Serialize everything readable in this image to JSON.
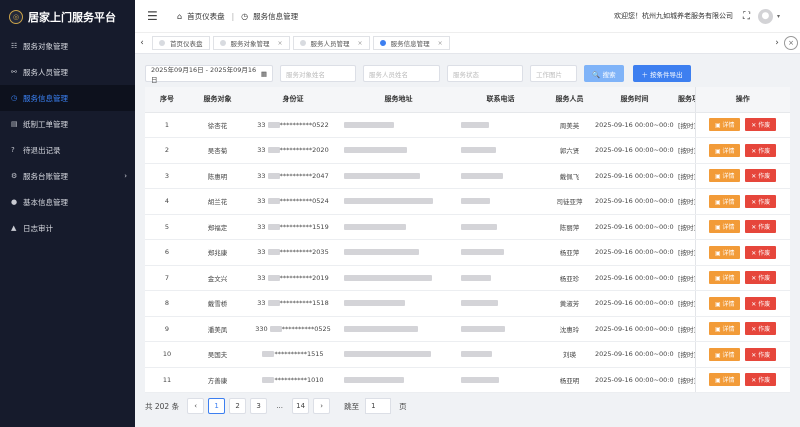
{
  "app": {
    "title": "居家上门服务平台",
    "logo_glyph": "◎"
  },
  "sidebar": {
    "items": [
      {
        "label": "服务对象管理",
        "icon": "users-icon",
        "glyph": "☷",
        "active": false
      },
      {
        "label": "服务人员管理",
        "icon": "staff-icon",
        "glyph": "⚯",
        "active": false
      },
      {
        "label": "服务信息管理",
        "icon": "clock-icon",
        "glyph": "◷",
        "active": true
      },
      {
        "label": "纸制工单管理",
        "icon": "document-icon",
        "glyph": "▤",
        "active": false
      },
      {
        "label": "待退出记录",
        "icon": "question-icon",
        "glyph": "?",
        "active": false
      },
      {
        "label": "服务台账管理",
        "icon": "ledger-icon",
        "glyph": "⚙",
        "active": false,
        "expandable": true
      },
      {
        "label": "基本信息管理",
        "icon": "info-icon",
        "glyph": "●",
        "active": false
      },
      {
        "label": "日志审计",
        "icon": "warning-icon",
        "glyph": "▲",
        "active": false
      }
    ]
  },
  "header": {
    "breadcrumb": [
      {
        "label": "首页仪表盘",
        "glyph": "⌂"
      },
      {
        "label": "服务信息管理",
        "glyph": "◷"
      }
    ],
    "welcome": "欢迎您！杭州九如城养老服务有限公司",
    "fullscreen_glyph": "⛶",
    "avatar_glyph": "●",
    "caret_glyph": "▾",
    "menu_glyph": "☰"
  },
  "tabs": {
    "items": [
      {
        "label": "首页仪表盘",
        "closable": false,
        "active": false
      },
      {
        "label": "服务对象管理",
        "closable": true,
        "active": false
      },
      {
        "label": "服务人员管理",
        "closable": true,
        "active": false
      },
      {
        "label": "服务信息管理",
        "closable": true,
        "active": true
      }
    ],
    "prev_glyph": "‹",
    "next_glyph": "›",
    "close_glyph": "×"
  },
  "filters": {
    "date_range": "2025年09月16日 - 2025年09月16日",
    "calendar_glyph": "▦",
    "client_placeholder": "服务对象姓名",
    "staff_placeholder": "服务人员姓名",
    "status_placeholder": "服务状态",
    "photo_placeholder": "工作图片",
    "search_label": "🔍 搜索",
    "export_label": "＋ 按条件导出"
  },
  "table": {
    "headers": [
      "序号",
      "服务对象",
      "身份证",
      "服务地址",
      "联系电话",
      "服务人员",
      "服务时间",
      "服务项目",
      "操作"
    ],
    "detail_label": "▣ 详情",
    "void_label": "✕ 作废",
    "rows": [
      {
        "no": "1",
        "client": "徐杏花",
        "id_prefix": "33",
        "id_suffix": "**********0522",
        "staff": "周美英",
        "time": "2025-09-16 00:00~00:00",
        "item": "[按时]起居活/制作"
      },
      {
        "no": "2",
        "client": "吴杏菊",
        "id_prefix": "33",
        "id_suffix": "**********2020",
        "staff": "郭六贤",
        "time": "2025-09-16 00:00~00:00",
        "item": "[按时]起居活/制作"
      },
      {
        "no": "3",
        "client": "陈惠明",
        "id_prefix": "33",
        "id_suffix": "**********2047",
        "staff": "戴佩飞",
        "time": "2025-09-16 00:00~00:00",
        "item": "[按时]起居活/制作"
      },
      {
        "no": "4",
        "client": "胡兰花",
        "id_prefix": "33",
        "id_suffix": "**********0524",
        "staff": "司徒亚萍",
        "time": "2025-09-16 00:00~00:00",
        "item": "[按时]起居活/制作"
      },
      {
        "no": "5",
        "client": "郑福定",
        "id_prefix": "33",
        "id_suffix": "**********1519",
        "staff": "陈丽萍",
        "time": "2025-09-16 00:00~00:00",
        "item": "[按时]起居活/制作"
      },
      {
        "no": "6",
        "client": "郑兆康",
        "id_prefix": "33",
        "id_suffix": "**********2035",
        "staff": "杨亚萍",
        "time": "2025-09-16 00:00~00:00",
        "item": "[按时]起居活/制作"
      },
      {
        "no": "7",
        "client": "金文兴",
        "id_prefix": "33",
        "id_suffix": "**********2019",
        "staff": "杨亚珍",
        "time": "2025-09-16 00:00~00:00",
        "item": "[按时]起居活/制作"
      },
      {
        "no": "8",
        "client": "戴雪桥",
        "id_prefix": "33",
        "id_suffix": "**********1518",
        "staff": "黄淑芳",
        "time": "2025-09-16 00:00~00:00",
        "item": "[按时]起居活/制作"
      },
      {
        "no": "9",
        "client": "潘美凤",
        "id_prefix": "330",
        "id_suffix": "**********0525",
        "staff": "沈惠玲",
        "time": "2025-09-16 00:00~00:00",
        "item": "[按时]起居活/制作"
      },
      {
        "no": "10",
        "client": "吴国夫",
        "id_prefix": "",
        "id_suffix": "**********1515",
        "staff": "刘瑛",
        "time": "2025-09-16 00:00~00:00",
        "item": "[按时]起居活/制作"
      },
      {
        "no": "11",
        "client": "方善康",
        "id_prefix": "",
        "id_suffix": "**********1010",
        "staff": "杨亚明",
        "time": "2025-09-16 00:00~00:00",
        "item": "[按时]起居活/制作"
      }
    ]
  },
  "pagination": {
    "total_label": "共 202 条",
    "prev_glyph": "‹",
    "next_glyph": "›",
    "pages": [
      "1",
      "2",
      "3",
      "...",
      "14"
    ],
    "current": "1",
    "jump_label": "跳至",
    "jump_value": "1",
    "page_unit": "页"
  }
}
